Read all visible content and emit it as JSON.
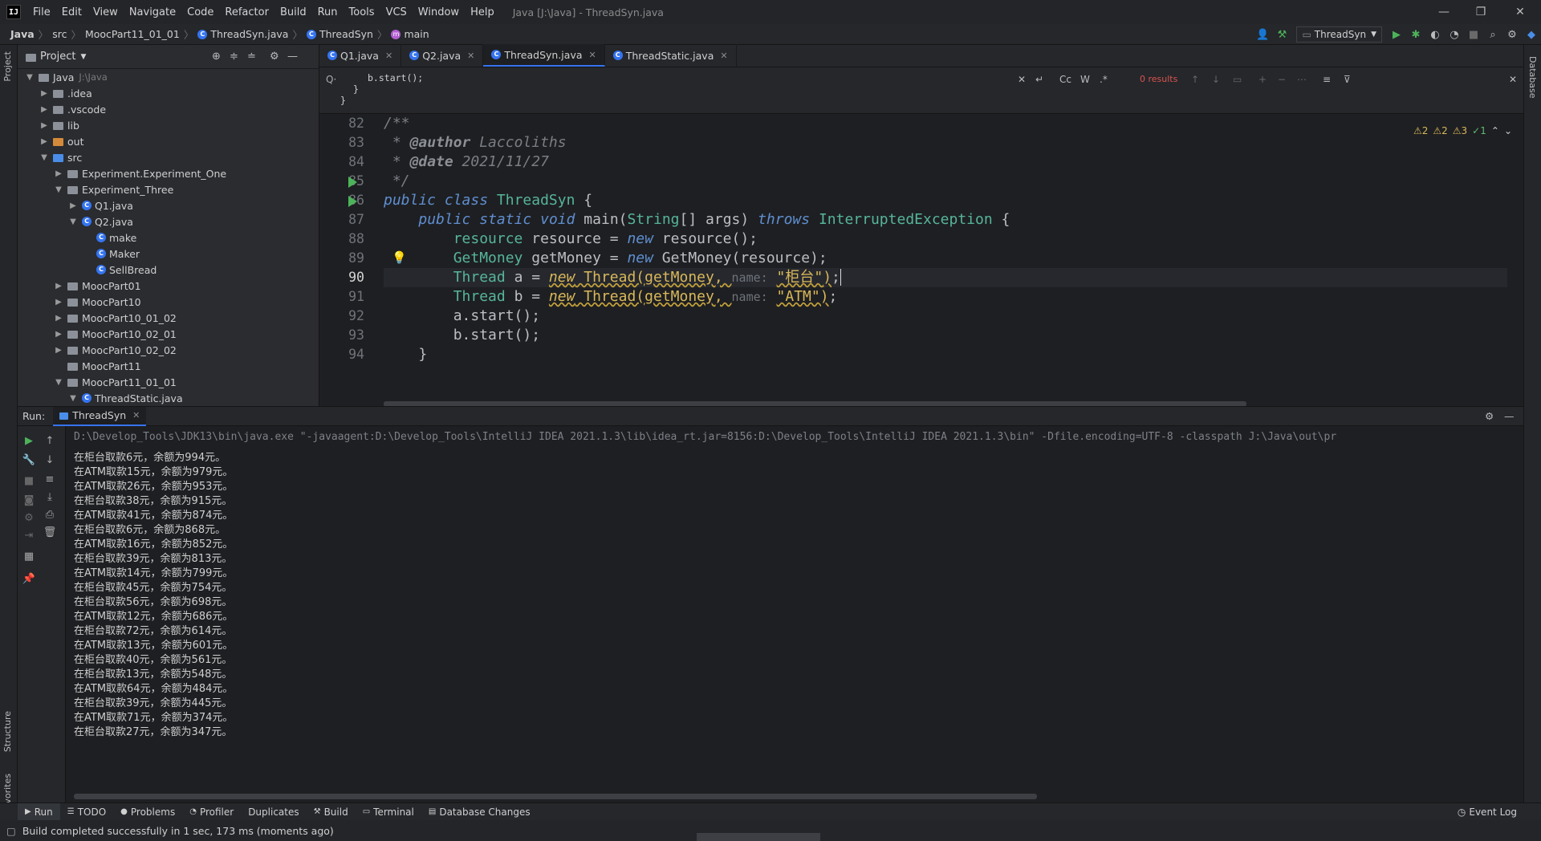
{
  "menubar": {
    "logo": "IJ",
    "items": [
      "File",
      "Edit",
      "View",
      "Navigate",
      "Code",
      "Refactor",
      "Build",
      "Run",
      "Tools",
      "VCS",
      "Window",
      "Help"
    ],
    "window_title": "Java [J:\\Java] - ThreadSyn.java"
  },
  "navbar": {
    "crumbs": [
      "Java",
      "src",
      "MoocPart11_01_01",
      "ThreadSyn.java",
      "ThreadSyn",
      "main"
    ],
    "run_config": "ThreadSyn"
  },
  "project": {
    "title": "Project",
    "tree": [
      {
        "label": "Java",
        "dim": "J:\\Java",
        "depth": 0,
        "arrow": "▼",
        "icon": "folder"
      },
      {
        "label": ".idea",
        "depth": 1,
        "arrow": "▶",
        "icon": "folder"
      },
      {
        "label": ".vscode",
        "depth": 1,
        "arrow": "▶",
        "icon": "folder"
      },
      {
        "label": "lib",
        "depth": 1,
        "arrow": "▶",
        "icon": "folder"
      },
      {
        "label": "out",
        "depth": 1,
        "arrow": "▶",
        "icon": "folder-orange"
      },
      {
        "label": "src",
        "depth": 1,
        "arrow": "▼",
        "icon": "folder-blue"
      },
      {
        "label": "Experiment.Experiment_One",
        "depth": 2,
        "arrow": "▶",
        "icon": "package"
      },
      {
        "label": "Experiment_Three",
        "depth": 2,
        "arrow": "▼",
        "icon": "package"
      },
      {
        "label": "Q1.java",
        "depth": 3,
        "arrow": "▶",
        "icon": "class"
      },
      {
        "label": "Q2.java",
        "depth": 3,
        "arrow": "▼",
        "icon": "class"
      },
      {
        "label": "make",
        "depth": 4,
        "arrow": "",
        "icon": "class"
      },
      {
        "label": "Maker",
        "depth": 4,
        "arrow": "",
        "icon": "class"
      },
      {
        "label": "SellBread",
        "depth": 4,
        "arrow": "",
        "icon": "class"
      },
      {
        "label": "MoocPart01",
        "depth": 2,
        "arrow": "▶",
        "icon": "package"
      },
      {
        "label": "MoocPart10",
        "depth": 2,
        "arrow": "▶",
        "icon": "package"
      },
      {
        "label": "MoocPart10_01_02",
        "depth": 2,
        "arrow": "▶",
        "icon": "package"
      },
      {
        "label": "MoocPart10_02_01",
        "depth": 2,
        "arrow": "▶",
        "icon": "package"
      },
      {
        "label": "MoocPart10_02_02",
        "depth": 2,
        "arrow": "▶",
        "icon": "package"
      },
      {
        "label": "MoocPart11",
        "depth": 2,
        "arrow": "",
        "icon": "package"
      },
      {
        "label": "MoocPart11_01_01",
        "depth": 2,
        "arrow": "▼",
        "icon": "package"
      },
      {
        "label": "ThreadStatic.java",
        "depth": 3,
        "arrow": "▼",
        "icon": "class"
      }
    ]
  },
  "editor": {
    "tabs": [
      {
        "label": "Q1.java",
        "active": false
      },
      {
        "label": "Q2.java",
        "active": false
      },
      {
        "label": "ThreadSyn.java",
        "active": true
      },
      {
        "label": "ThreadStatic.java",
        "active": false
      }
    ],
    "find": {
      "snippet": [
        "b.start();",
        "}",
        "}"
      ],
      "results": "0 results",
      "opt_cc": "Cc",
      "opt_w": "W",
      "opt_re": ".*"
    },
    "inspections": [
      "⚠2",
      "⚠2",
      "⚠3",
      "✓1"
    ],
    "line_numbers": [
      "82",
      "83",
      "84",
      "85",
      "86",
      "87",
      "88",
      "89",
      "90",
      "91",
      "92",
      "93",
      "94"
    ],
    "current_line": "90",
    "comment_author": "Laccoliths",
    "comment_date": "2021/11/27",
    "hint_name": "name:",
    "str_counter": "\"柜台\"",
    "str_atm": "\"ATM\""
  },
  "run": {
    "label": "Run:",
    "tab": "ThreadSyn",
    "command": "D:\\Develop_Tools\\JDK13\\bin\\java.exe \"-javaagent:D:\\Develop_Tools\\IntelliJ IDEA 2021.1.3\\lib\\idea_rt.jar=8156:D:\\Develop_Tools\\IntelliJ IDEA 2021.1.3\\bin\" -Dfile.encoding=UTF-8 -classpath J:\\Java\\out\\pr",
    "output": [
      "在柜台取款6元，余额为994元。",
      "在ATM取款15元，余额为979元。",
      "在ATM取款26元，余额为953元。",
      "在柜台取款38元，余额为915元。",
      "在ATM取款41元，余额为874元。",
      "在柜台取款6元，余额为868元。",
      "在ATM取款16元，余额为852元。",
      "在柜台取款39元，余额为813元。",
      "在ATM取款14元，余额为799元。",
      "在柜台取款45元，余额为754元。",
      "在柜台取款56元，余额为698元。",
      "在ATM取款12元，余额为686元。",
      "在柜台取款72元，余额为614元。",
      "在ATM取款13元，余额为601元。",
      "在柜台取款40元，余额为561元。",
      "在柜台取款13元，余额为548元。",
      "在ATM取款64元，余额为484元。",
      "在柜台取款39元，余额为445元。",
      "在ATM取款71元，余额为374元。",
      "在柜台取款27元，余额为347元。"
    ]
  },
  "bottombar": {
    "items": [
      "Run",
      "TODO",
      "Problems",
      "Profiler",
      "Duplicates",
      "Build",
      "Terminal",
      "Database Changes"
    ],
    "event_log": "Event Log"
  },
  "statusbar": {
    "message": "Build completed successfully in 1 sec, 173 ms (moments ago)"
  },
  "side": {
    "left_project": "Project",
    "left_structure": "Structure",
    "left_favorites": "Favorites",
    "right_database": "Database"
  },
  "colors": {
    "accent": "#3574f0",
    "run_green": "#4db35a",
    "keyword": "#5f8fd1",
    "type": "#56b59a",
    "string": "#d9a85a"
  }
}
